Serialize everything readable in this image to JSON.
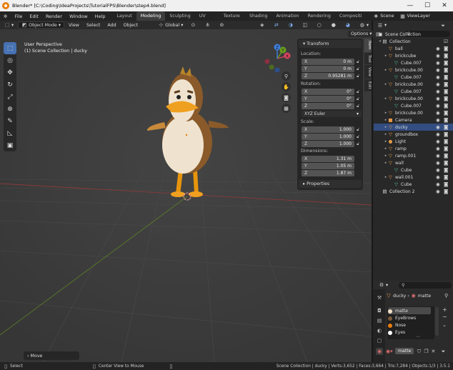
{
  "window": {
    "title": "Blender* [C:\\Coding\\IdeaProjects\\TutorialFPS\\Blender\\step4.blend]",
    "min": "—",
    "max": "☐",
    "close": "✕"
  },
  "menu": [
    "File",
    "Edit",
    "Render",
    "Window",
    "Help"
  ],
  "workspaces": [
    "Layout",
    "Modeling",
    "Sculpting",
    "UV Editing",
    "Texture Paint",
    "Shading",
    "Animation",
    "Rendering",
    "Compositi"
  ],
  "scene": {
    "label": "Scene",
    "viewlayer": "ViewLayer"
  },
  "viewport_header": {
    "mode": "Object Mode",
    "menus": [
      "View",
      "Select",
      "Add",
      "Object"
    ],
    "orientation": "Global"
  },
  "viewport": {
    "view_name": "User Perspective",
    "collection_info": "(1) Scene Collection | ducky",
    "options": "Options",
    "last_op": "Move"
  },
  "gizmo": {
    "x": "X",
    "y": "Y",
    "z": "Z"
  },
  "npanel": {
    "tabs": [
      "Item",
      "Tool",
      "View",
      "Edit"
    ],
    "transform_title": "Transform",
    "location_label": "Location:",
    "location": [
      {
        "k": "X",
        "v": "0 m"
      },
      {
        "k": "Y",
        "v": "0 m"
      },
      {
        "k": "Z",
        "v": "0.95281 m"
      }
    ],
    "rotation_label": "Rotation:",
    "rotation": [
      {
        "k": "X",
        "v": "0°"
      },
      {
        "k": "Y",
        "v": "0°"
      },
      {
        "k": "Z",
        "v": "0°"
      }
    ],
    "rotation_mode": "XYZ Euler",
    "scale_label": "Scale:",
    "scale": [
      {
        "k": "X",
        "v": "1.000"
      },
      {
        "k": "Y",
        "v": "1.000"
      },
      {
        "k": "Z",
        "v": "1.000"
      }
    ],
    "dimensions_label": "Dimensions:",
    "dimensions": [
      {
        "k": "X",
        "v": "1.31 m"
      },
      {
        "k": "Y",
        "v": "1.05 m"
      },
      {
        "k": "Z",
        "v": "1.87 m"
      }
    ],
    "properties_title": "Properties"
  },
  "outliner": {
    "scene_collection": "Scene Collection",
    "rows": [
      {
        "name": "Collection",
        "icon": "collection-icon",
        "glyph": "▤",
        "color": "#ddd",
        "sel": false
      },
      {
        "name": "ball",
        "icon": "object-icon",
        "glyph": "▽",
        "color": "#e89b4a",
        "sel": false
      },
      {
        "name": "brickcube",
        "icon": "object-icon",
        "glyph": "▽",
        "color": "#e89b4a",
        "sel": false
      },
      {
        "name": "Cube.007",
        "icon": "mesh-icon",
        "glyph": "▽",
        "color": "#4fc3a1",
        "sel": false
      },
      {
        "name": "brickcube.00",
        "icon": "object-icon",
        "glyph": "▽",
        "color": "#e89b4a",
        "sel": false
      },
      {
        "name": "Cube.007",
        "icon": "mesh-icon",
        "glyph": "▽",
        "color": "#4fc3a1",
        "sel": false
      },
      {
        "name": "brickcube.00",
        "icon": "object-icon",
        "glyph": "▽",
        "color": "#e89b4a",
        "sel": false
      },
      {
        "name": "Cube.007",
        "icon": "mesh-icon",
        "glyph": "▽",
        "color": "#4fc3a1",
        "sel": false
      },
      {
        "name": "brickcube.00",
        "icon": "object-icon",
        "glyph": "▽",
        "color": "#e89b4a",
        "sel": false
      },
      {
        "name": "Cube.007",
        "icon": "mesh-icon",
        "glyph": "▽",
        "color": "#4fc3a1",
        "sel": false
      },
      {
        "name": "brickcube.00",
        "icon": "object-icon",
        "glyph": "▽",
        "color": "#e89b4a",
        "sel": false
      },
      {
        "name": "Camera",
        "icon": "camera-icon",
        "glyph": "■",
        "color": "#e89b4a",
        "sel": false
      },
      {
        "name": "ducky",
        "icon": "object-icon",
        "glyph": "▽",
        "color": "#e89b4a",
        "sel": true
      },
      {
        "name": "groundbox",
        "icon": "object-icon",
        "glyph": "▽",
        "color": "#e89b4a",
        "sel": false
      },
      {
        "name": "Light",
        "icon": "light-icon",
        "glyph": "●",
        "color": "#e89b4a",
        "sel": false
      },
      {
        "name": "ramp",
        "icon": "object-icon",
        "glyph": "▽",
        "color": "#e89b4a",
        "sel": false
      },
      {
        "name": "ramp.001",
        "icon": "object-icon",
        "glyph": "▽",
        "color": "#e89b4a",
        "sel": false
      },
      {
        "name": "wall",
        "icon": "object-icon",
        "glyph": "▽",
        "color": "#e89b4a",
        "sel": false
      },
      {
        "name": "Cube",
        "icon": "mesh-icon",
        "glyph": "▽",
        "color": "#4fc3a1",
        "sel": false
      },
      {
        "name": "wall.001",
        "icon": "object-icon",
        "glyph": "▽",
        "color": "#e89b4a",
        "sel": false
      },
      {
        "name": "Cube",
        "icon": "mesh-icon",
        "glyph": "▽",
        "color": "#4fc3a1",
        "sel": false
      },
      {
        "name": "Collection 2",
        "icon": "collection-icon",
        "glyph": "▤",
        "color": "#ddd",
        "sel": false
      }
    ]
  },
  "properties": {
    "object": "ducky",
    "material": "matte",
    "slots": [
      {
        "name": "matte",
        "color": "#f0e0c8"
      },
      {
        "name": "EyeBrows",
        "color": "#7a5a3a"
      },
      {
        "name": "Nose",
        "color": "#e87d0d"
      },
      {
        "name": "Eyes",
        "color": "#ffffff"
      }
    ],
    "material_field": "matte"
  },
  "statusbar": {
    "select": "Select",
    "center": "Center View to Mouse",
    "stats": "Scene Collection | ducky | Verts:3,652 | Faces:3,664 | Tris:7,284 | Objects:1/3 | 3.5.1"
  }
}
